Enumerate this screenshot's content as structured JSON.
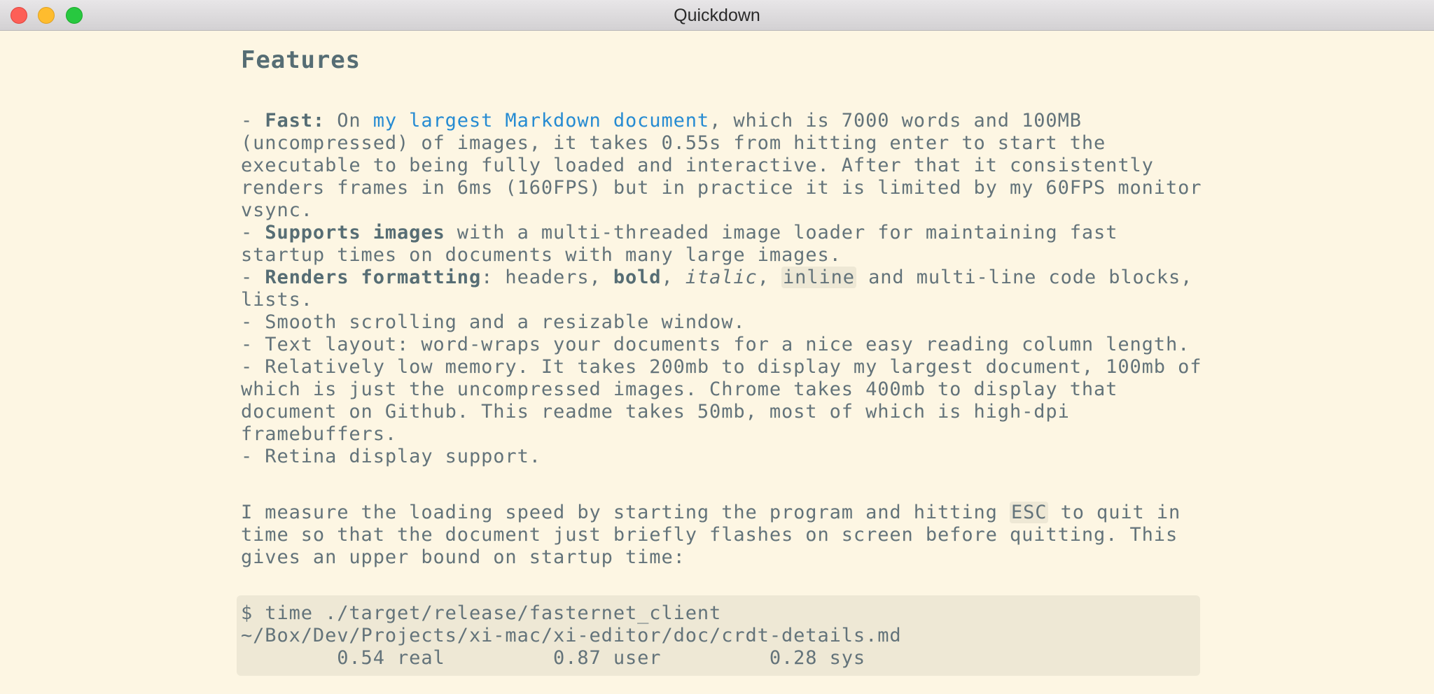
{
  "window": {
    "title": "Quickdown"
  },
  "doc": {
    "heading": "Features",
    "features": [
      [
        "- ",
        {
          "b": "Fast:"
        },
        " On ",
        {
          "a": "my largest Markdown document"
        },
        ", which is 7000 words and 100MB"
      ],
      [
        "(uncompressed) of images, it takes 0.55s from hitting enter to start the"
      ],
      [
        "executable to being fully loaded and interactive. After that it consistently"
      ],
      [
        "renders frames in 6ms (160FPS) but in practice it is limited by my 60FPS monitor"
      ],
      [
        "vsync."
      ],
      [
        "- ",
        {
          "b": "Supports images"
        },
        " with a multi-threaded image loader for maintaining fast"
      ],
      [
        "startup times on documents with many large images."
      ],
      [
        "- ",
        {
          "b": "Renders formatting"
        },
        ": headers, ",
        {
          "b": "bold"
        },
        ", ",
        {
          "i": "italic"
        },
        ", ",
        {
          "c": "inline"
        },
        " and multi-line code blocks,"
      ],
      [
        "lists."
      ],
      [
        "- Smooth scrolling and a resizable window."
      ],
      [
        "- Text layout: word-wraps your documents for a nice easy reading column length."
      ],
      [
        "- Relatively low memory. It takes 200mb to display my largest document, 100mb of"
      ],
      [
        "which is just the uncompressed images. Chrome takes 400mb to display that"
      ],
      [
        "document on Github. This readme takes 50mb, most of which is high-dpi"
      ],
      [
        "framebuffers."
      ],
      [
        "- Retina display support."
      ]
    ],
    "measure": [
      [
        "I measure the loading speed by starting the program and hitting ",
        {
          "c": "ESC"
        },
        " to quit in"
      ],
      [
        "time so that the document just briefly flashes on screen before quitting. This"
      ],
      [
        "gives an upper bound on startup time:"
      ]
    ],
    "codeblock": [
      "$ time ./target/release/fasternet_client",
      "~/Box/Dev/Projects/xi-mac/xi-editor/doc/crdt-details.md",
      "        0.54 real         0.87 user         0.28 sys"
    ]
  }
}
